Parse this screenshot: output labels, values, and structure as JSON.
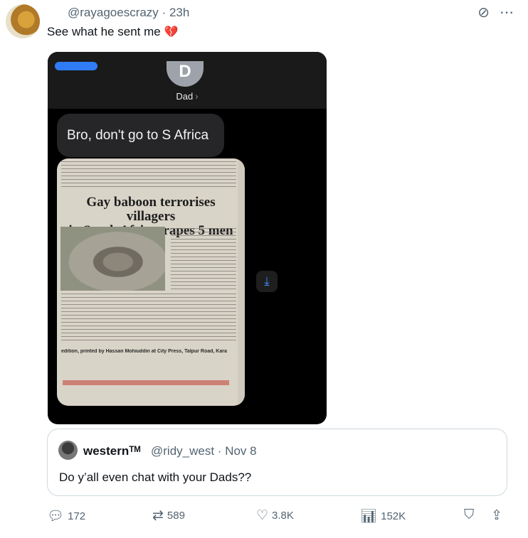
{
  "tweet": {
    "handle": "@rayagoescrazy",
    "separator": "·",
    "time": "23h",
    "text": "See what he sent me",
    "emoji": "💔"
  },
  "media": {
    "contact_initial": "D",
    "contact_name": "Dad",
    "message": "Bro, don't go to S Africa",
    "newspaper": {
      "headline_line1": "Gay baboon terrorises villagers",
      "headline_line2": "in South Africa, rapes 5 men",
      "footer": "edition, printed by Hassan Mohiuddin at City Press, Talpur Road, Kara"
    }
  },
  "quote": {
    "name": "westernᵀᴹ",
    "handle": "@ridy_west",
    "separator": "·",
    "date": "Nov 8",
    "text": "Do y’all even chat with your Dads??"
  },
  "actions": {
    "replies": "172",
    "reposts": "589",
    "likes": "3.8K",
    "views": "152K"
  },
  "icons": {
    "grok": "slash-circle-icon",
    "more": "more-icon",
    "reply": "reply-icon",
    "repost": "repost-icon",
    "like": "heart-icon",
    "views": "views-icon",
    "bookmark": "bookmark-icon",
    "share": "share-icon"
  },
  "colors": {
    "muted": "#536471",
    "border": "#cfd9de",
    "imessage_blue": "#2f7cf6"
  }
}
